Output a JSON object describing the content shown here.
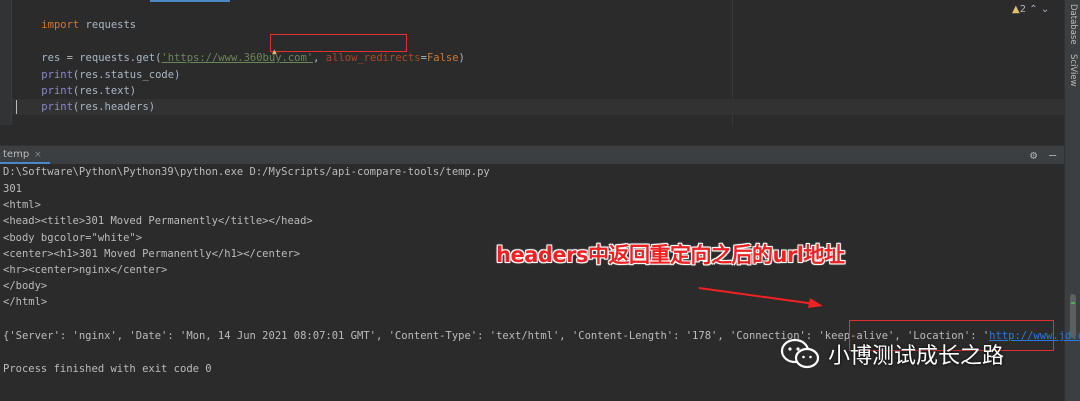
{
  "editor": {
    "lines": {
      "l1_kw": "import",
      "l1_rest": " requests",
      "l3_a": "res = requests.get(",
      "l3_url": "'https://www.360buy.com'",
      "l3_comma": ", ",
      "l3_param": "allow_redirects",
      "l3_eq": "=",
      "l3_false": "False",
      "l3_close": ")",
      "l4_fn": "print",
      "l4_rest": "(res.status_code)",
      "l5_fn": "print",
      "l5_rest": "(res.text)",
      "l6_fn": "print",
      "l6_rest": "(res.headers)"
    },
    "inspection": {
      "warning_count": "2",
      "up": "⌃",
      "down": "⌄"
    }
  },
  "right_strip": {
    "database_label": "Database",
    "sciview_label": "SciView"
  },
  "run_window": {
    "tab_label": "temp",
    "tab_close": "×"
  },
  "console": {
    "lines": [
      "D:\\Software\\Python\\Python39\\python.exe D:/MyScripts/api-compare-tools/temp.py",
      "301",
      "<html>",
      "<head><title>301 Moved Permanently</title></head>",
      "<body bgcolor=\"white\">",
      "<center><h1>301 Moved Permanently</h1></center>",
      "<hr><center>nginx</center>",
      "</body>",
      "</html>"
    ],
    "headers_line_prefix": "{'Server': 'nginx', 'Date': 'Mon, 14 Jun 2021 08:07:01 GMT', 'Content-Type': 'text/html', 'Content-Length': '178', 'Connection': 'keep-alive', 'Location': '",
    "headers_line_link": "http://www.jd.com/",
    "headers_line_suffix": "', '",
    "finished": "Process finished with exit code 0"
  },
  "annotation": {
    "text": "headers中返回重定向之后的url地址"
  },
  "watermark": {
    "text": "小博测试成长之路"
  },
  "colors": {
    "annotation_red": "#ee2222",
    "box_red": "#e03030",
    "keyword": "#cc7832",
    "string": "#6a8759",
    "builtin": "#8888c6",
    "link": "#287bde"
  }
}
